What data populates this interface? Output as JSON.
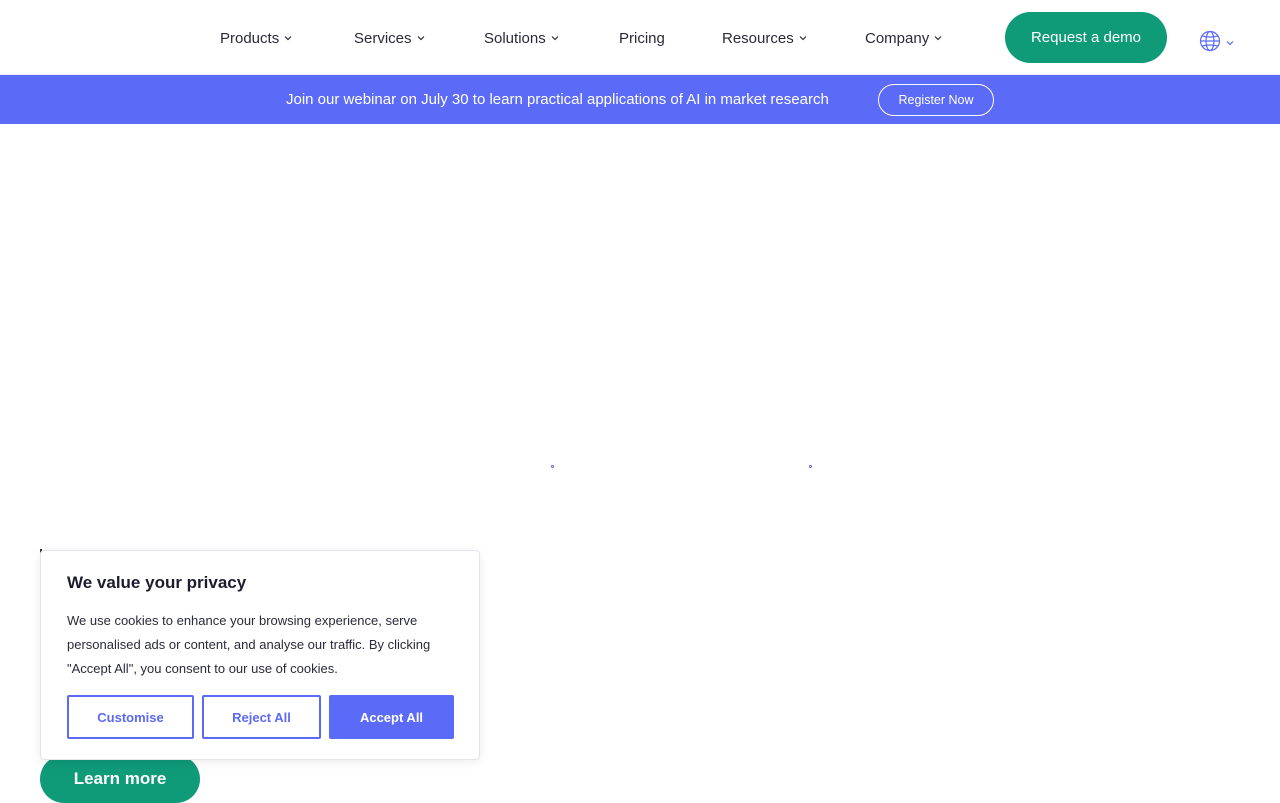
{
  "nav": {
    "items": [
      {
        "label": "Products",
        "dropdown": true
      },
      {
        "label": "Services",
        "dropdown": true
      },
      {
        "label": "Solutions",
        "dropdown": true
      },
      {
        "label": "Pricing",
        "dropdown": false
      },
      {
        "label": "Resources",
        "dropdown": true
      },
      {
        "label": "Company",
        "dropdown": true
      }
    ],
    "demo_label": "Request a demo",
    "language_icon": "globe-icon"
  },
  "banner": {
    "text": "Join our webinar on July 30 to learn practical applications of AI in market research",
    "button_label": "Register Now"
  },
  "cookie": {
    "title": "We value your privacy",
    "body": "We use cookies to enhance your browsing experience, serve personalised ads or content, and analyse our traffic. By clicking \"Accept All\", you consent to our use of cookies.",
    "customise_label": "Customise",
    "reject_label": "Reject All",
    "accept_label": "Accept All"
  },
  "hero": {
    "learn_more_label": "Learn more"
  },
  "colors": {
    "brand_green": "#0f9a78",
    "accent_blue": "#5b6af7"
  }
}
